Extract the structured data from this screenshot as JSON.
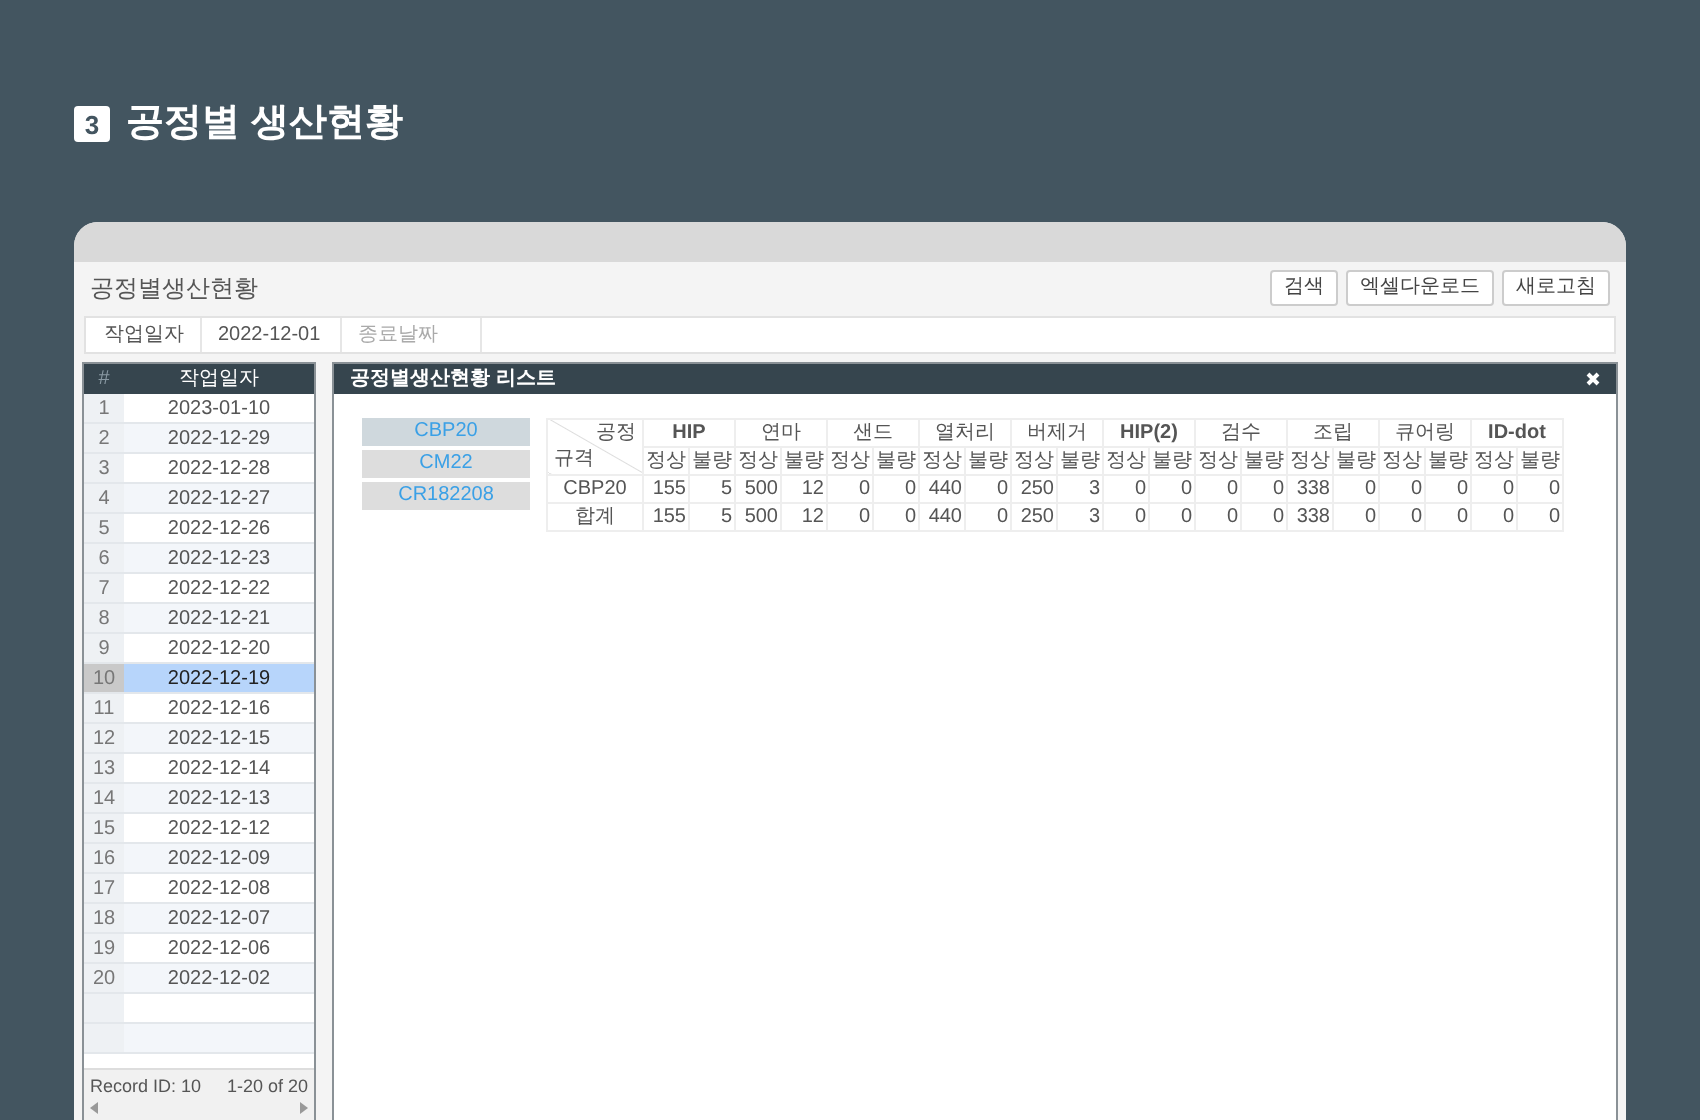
{
  "heading": {
    "number": "3",
    "title": "공정별 생산현황"
  },
  "window": {
    "title": "공정별생산현황",
    "buttons": [
      "검색",
      "엑셀다운로드",
      "새로고침"
    ]
  },
  "filter": {
    "label": "작업일자",
    "start": "2022-12-01",
    "end_placeholder": "종료날짜"
  },
  "date_grid": {
    "columns": [
      "#",
      "작업일자"
    ],
    "rows": [
      {
        "number": "1",
        "date": "2023-01-10",
        "selected": false
      },
      {
        "number": "2",
        "date": "2022-12-29",
        "selected": false
      },
      {
        "number": "3",
        "date": "2022-12-28",
        "selected": false
      },
      {
        "number": "4",
        "date": "2022-12-27",
        "selected": false
      },
      {
        "number": "5",
        "date": "2022-12-26",
        "selected": false
      },
      {
        "number": "6",
        "date": "2022-12-23",
        "selected": false
      },
      {
        "number": "7",
        "date": "2022-12-22",
        "selected": false
      },
      {
        "number": "8",
        "date": "2022-12-21",
        "selected": false
      },
      {
        "number": "9",
        "date": "2022-12-20",
        "selected": false
      },
      {
        "number": "10",
        "date": "2022-12-19",
        "selected": true
      },
      {
        "number": "11",
        "date": "2022-12-16",
        "selected": false
      },
      {
        "number": "12",
        "date": "2022-12-15",
        "selected": false
      },
      {
        "number": "13",
        "date": "2022-12-14",
        "selected": false
      },
      {
        "number": "14",
        "date": "2022-12-13",
        "selected": false
      },
      {
        "number": "15",
        "date": "2022-12-12",
        "selected": false
      },
      {
        "number": "16",
        "date": "2022-12-09",
        "selected": false
      },
      {
        "number": "17",
        "date": "2022-12-08",
        "selected": false
      },
      {
        "number": "18",
        "date": "2022-12-07",
        "selected": false
      },
      {
        "number": "19",
        "date": "2022-12-06",
        "selected": false
      },
      {
        "number": "20",
        "date": "2022-12-02",
        "selected": false
      }
    ],
    "footer_left": "Record ID: 10",
    "footer_right": "1-20 of 20"
  },
  "panel": {
    "title": "공정별생산현황 리스트",
    "specs": [
      {
        "label": "CBP20",
        "selected": true
      },
      {
        "label": "CM22",
        "selected": false
      },
      {
        "label": "CR182208",
        "selected": false
      }
    ],
    "table": {
      "corner_top": "공정",
      "corner_bottom": "규격",
      "processes": [
        {
          "name": "HIP",
          "bold": true,
          "subcolumns": [
            "정상",
            "불량"
          ]
        },
        {
          "name": "연마",
          "bold": false,
          "subcolumns": [
            "정상",
            "불량"
          ]
        },
        {
          "name": "샌드",
          "bold": false,
          "subcolumns": [
            "정상",
            "불량"
          ]
        },
        {
          "name": "열처리",
          "bold": false,
          "subcolumns": [
            "정상",
            "불량"
          ]
        },
        {
          "name": "버제거",
          "bold": false,
          "subcolumns": [
            "정상",
            "불량"
          ]
        },
        {
          "name": "HIP(2)",
          "bold": true,
          "subcolumns": [
            "정상",
            "불량"
          ]
        },
        {
          "name": "검수",
          "bold": false,
          "subcolumns": [
            "정상",
            "불량"
          ]
        },
        {
          "name": "조립",
          "bold": false,
          "subcolumns": [
            "정상",
            "불량"
          ]
        },
        {
          "name": "큐어링",
          "bold": false,
          "subcolumns": [
            "정상",
            "불량"
          ]
        },
        {
          "name": "ID-dot",
          "bold": true,
          "subcolumns": [
            "정상",
            "불량"
          ]
        }
      ],
      "rows": [
        {
          "label": "CBP20",
          "values": [
            "155",
            "5",
            "500",
            "12",
            "0",
            "0",
            "440",
            "0",
            "250",
            "3",
            "0",
            "0",
            "0",
            "0",
            "338",
            "0",
            "0",
            "0",
            "0",
            "0"
          ]
        },
        {
          "label": "합계",
          "values": [
            "155",
            "5",
            "500",
            "12",
            "0",
            "0",
            "440",
            "0",
            "250",
            "3",
            "0",
            "0",
            "0",
            "0",
            "338",
            "0",
            "0",
            "0",
            "0",
            "0"
          ]
        }
      ]
    }
  }
}
